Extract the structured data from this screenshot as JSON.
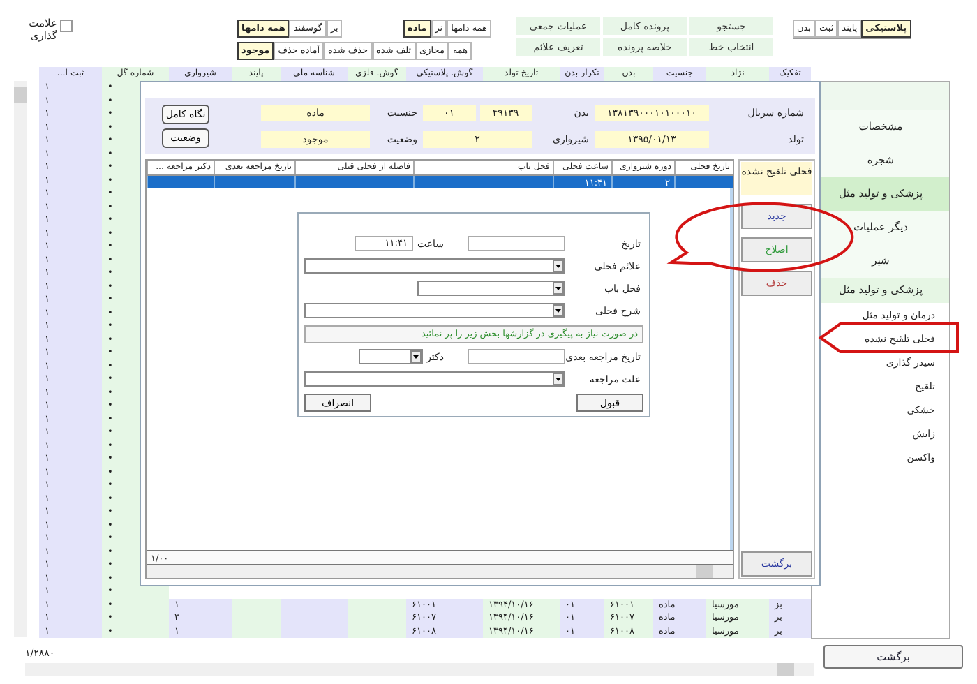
{
  "mark_checkbox": {
    "label": "علامت گذاری",
    "checked": false
  },
  "filter_tabs": {
    "sex": [
      {
        "label": "همه دامها",
        "selected": false
      },
      {
        "label": "نر",
        "selected": false
      },
      {
        "label": "ماده",
        "selected": true
      }
    ],
    "species": [
      {
        "label": "بز",
        "selected": false
      },
      {
        "label": "گوسفند",
        "selected": false
      },
      {
        "label": "همه دامها",
        "selected": true
      }
    ],
    "status": [
      {
        "label": "همه",
        "selected": false
      },
      {
        "label": "مجازی",
        "selected": false
      },
      {
        "label": "تلف شده",
        "selected": false
      },
      {
        "label": "حذف شده",
        "selected": false
      },
      {
        "label": "آماده حذف",
        "selected": false
      },
      {
        "label": "موجود",
        "selected": true
      }
    ]
  },
  "actions": [
    [
      "جستجو",
      "پرونده کامل",
      "عملیات جمعی"
    ],
    [
      "انتخاب خط",
      "خلاصه پرونده",
      "تعریف علائم"
    ]
  ],
  "id_tabs": [
    {
      "label": "پلاستیکی",
      "selected": true
    },
    {
      "label": "پایند",
      "selected": false
    },
    {
      "label": "ثبت",
      "selected": false
    },
    {
      "label": "بدن",
      "selected": false
    }
  ],
  "table": {
    "columns": [
      "تفکیک",
      "نژاد",
      "جنسیت",
      "بدن",
      "تکرار بدن",
      "تاریخ تولد",
      "گوش. پلاستیکی",
      "گوش. فلزی",
      "شناسه ملی",
      "پایند",
      "شیرواری",
      "شماره گل",
      "ثبت ا..."
    ],
    "rows": [
      {
        "cells": [
          "•",
          "۱"
        ]
      },
      {
        "cells": [
          "•",
          "۱"
        ]
      },
      {
        "cells": [
          "•",
          "۱"
        ]
      },
      {
        "cells": [
          "•",
          "۱"
        ]
      },
      {
        "cells": [
          "•",
          "۱"
        ]
      },
      {
        "cells": [
          "•",
          "۱"
        ]
      },
      {
        "cells": [
          "•",
          "۱"
        ]
      },
      {
        "cells": [
          "•",
          "۱"
        ]
      },
      {
        "cells": [
          "•",
          "۱"
        ]
      },
      {
        "cells": [
          "•",
          "۱"
        ]
      },
      {
        "cells": [
          "•",
          "۱"
        ]
      },
      {
        "cells": [
          "•",
          "۱"
        ]
      },
      {
        "cells": [
          "•",
          "۱"
        ]
      },
      {
        "cells": [
          "•",
          "۱"
        ]
      },
      {
        "cells": [
          "•",
          "۱"
        ]
      },
      {
        "cells": [
          "•",
          "۱"
        ]
      },
      {
        "cells": [
          "•",
          "۱"
        ]
      },
      {
        "cells": [
          "•",
          "۱"
        ]
      },
      {
        "cells": [
          "•",
          "۱"
        ]
      },
      {
        "cells": [
          "•",
          "۱"
        ]
      },
      {
        "cells": [
          "•",
          "۱"
        ]
      },
      {
        "cells": [
          "•",
          "۱"
        ]
      },
      {
        "cells": [
          "•",
          "۱"
        ]
      },
      {
        "cells": [
          "•",
          "۱"
        ]
      },
      {
        "cells": [
          "•",
          "۱"
        ]
      },
      {
        "cells": [
          "•",
          "۱"
        ]
      },
      {
        "cells": [
          "•",
          "۱"
        ]
      },
      {
        "cells": [
          "•",
          "۱"
        ]
      },
      {
        "cells": [
          "•",
          "۱"
        ]
      },
      {
        "cells": [
          "•",
          "۱"
        ]
      },
      {
        "cells": [
          "•",
          "۱"
        ]
      },
      {
        "cells": [
          "•",
          "۱"
        ]
      },
      {
        "cells": [
          "•",
          "۱"
        ]
      },
      {
        "cells": [
          "•",
          "۱"
        ]
      },
      {
        "cells": [
          "•",
          "۱"
        ]
      },
      {
        "cells": [
          "•",
          "۱"
        ]
      },
      {
        "cells": [
          "•",
          "۱"
        ]
      },
      {
        "cells": [
          "•",
          "۱"
        ]
      },
      {
        "cells": [
          "•",
          "۱"
        ]
      },
      {
        "cells": [
          "بز",
          "مورسیا",
          "ماده",
          "۶۱۰۰۱",
          "۰۱",
          "۱۳۹۴/۱۰/۱۶",
          "۶۱۰۰۱",
          null,
          null,
          null,
          "۱",
          "•",
          "۱"
        ]
      },
      {
        "cells": [
          "بز",
          "مورسیا",
          "ماده",
          "۶۱۰۰۷",
          "۰۱",
          "۱۳۹۴/۱۰/۱۶",
          "۶۱۰۰۷",
          null,
          null,
          null,
          "۳",
          "•",
          "۱"
        ]
      },
      {
        "cells": [
          "بز",
          "مورسیا",
          "ماده",
          "۶۱۰۰۸",
          "۰۱",
          "۱۳۹۴/۱۰/۱۶",
          "۶۱۰۰۸",
          null,
          null,
          null,
          "۱",
          "•",
          "۱"
        ]
      }
    ]
  },
  "sidebar": [
    {
      "kind": "tab",
      "label": "مشخصات",
      "selected": false
    },
    {
      "kind": "tab",
      "label": "شجره",
      "selected": false
    },
    {
      "kind": "tab",
      "label": "پزشکی و تولید مثل",
      "selected": true
    },
    {
      "kind": "tab",
      "label": "دیگر عملیات",
      "selected": false
    },
    {
      "kind": "tab",
      "label": "شیر",
      "selected": false
    },
    {
      "kind": "heading",
      "label": "پزشکی و تولید مثل"
    },
    {
      "kind": "link",
      "label": "درمان و تولید مثل"
    },
    {
      "kind": "link",
      "label": "فحلی تلقیح نشده"
    },
    {
      "kind": "link",
      "label": "سیدر گذاری"
    },
    {
      "kind": "link",
      "label": "تلقیح"
    },
    {
      "kind": "link",
      "label": "خشکی"
    },
    {
      "kind": "link",
      "label": "زایش"
    },
    {
      "kind": "link",
      "label": "واکسن"
    }
  ],
  "footer": {
    "count": "۱/۲۸۸۰",
    "back": "برگشت"
  },
  "dialog": {
    "info": {
      "fields": [
        {
          "label": "شماره سریال",
          "values": [
            "۱۳۸۱۳۹۰۰۰۱۰۱۰۰۰۱۰"
          ]
        },
        {
          "label": "بدن",
          "values": [
            "۴۹۱۳۹",
            "۰۱"
          ]
        },
        {
          "label": "جنسیت",
          "values": [
            "ماده"
          ]
        },
        {
          "label": "تولد",
          "values": [
            "۱۳۹۵/۰۱/۱۳"
          ]
        },
        {
          "label": "شیرواری",
          "values": [
            "۲"
          ]
        },
        {
          "label": "وضعیت",
          "values": [
            "موجود"
          ]
        }
      ],
      "buttons": [
        "نگاه کامل",
        "وضعیت"
      ]
    },
    "panel_title": "فحلی تلقیح نشده",
    "side_buttons": [
      {
        "label": "جدید",
        "color": "#2b3aa0"
      },
      {
        "label": "اصلاح",
        "color": "#2f9a3a"
      },
      {
        "label": "حذف",
        "color": "#b03030"
      }
    ],
    "back": "برگشت",
    "grid": {
      "columns": [
        "تاریخ فحلی",
        "دوره شیرواری",
        "ساعت فحلی",
        "فحل باب",
        "فاصله از فحلی قبلی",
        "تاریخ مراجعه بعدی",
        "دکتر مراجعه ..."
      ],
      "rows": [
        {
          "selected": true,
          "cells": [
            null,
            "۲",
            "۱۱:۴۱",
            null,
            null,
            null,
            null
          ]
        }
      ],
      "footer": "۱/۰۰"
    }
  },
  "form": {
    "rows": [
      {
        "fields": [
          {
            "kind": "date-input",
            "label": "تاریخ"
          },
          {
            "kind": "time-input",
            "label": "ساعت",
            "value": "۱۱:۴۱"
          }
        ]
      },
      {
        "fields": [
          {
            "kind": "select",
            "label": "علائم فحلی"
          }
        ]
      },
      {
        "fields": [
          {
            "kind": "select-medium",
            "label": "فحل باب"
          }
        ]
      },
      {
        "fields": [
          {
            "kind": "select",
            "label": "شرح فحلی"
          }
        ]
      },
      {
        "fields": [
          {
            "kind": "note",
            "text": "در صورت نیاز به پیگیری در گزارشها بخش زیر را پر نمائید"
          }
        ]
      },
      {
        "fields": [
          {
            "kind": "date-input",
            "label": "تاریخ مراجعه بعدی"
          },
          {
            "kind": "select-small",
            "label": "دکتر"
          }
        ]
      },
      {
        "fields": [
          {
            "kind": "select",
            "label": "علت مراجعه"
          }
        ]
      }
    ],
    "buttons": [
      "قبول",
      "انصراف"
    ]
  }
}
